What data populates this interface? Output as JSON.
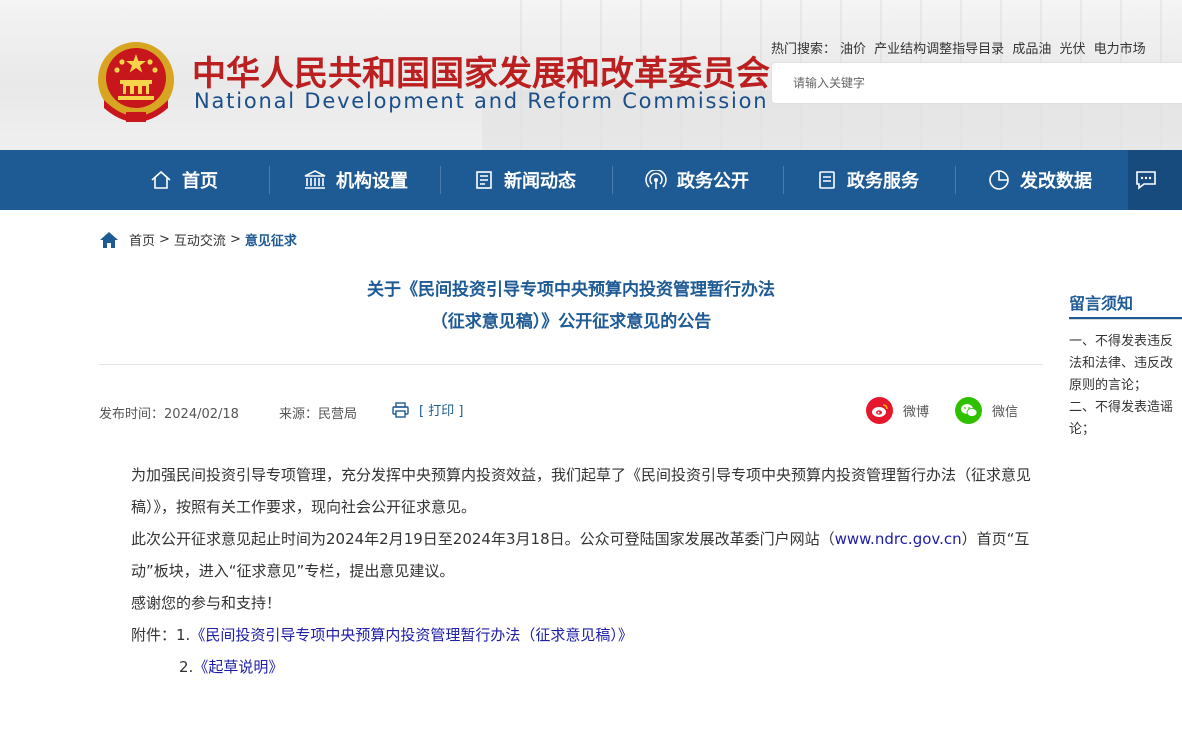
{
  "header": {
    "title_cn": "中华人民共和国国家发展和改革委员会",
    "title_en": "National Development and Reform Commission",
    "hot_search_label": "热门搜索：",
    "hot_search_terms": [
      "油价",
      "产业结构调整指导目录",
      "成品油",
      "光伏",
      "电力市场"
    ],
    "search_placeholder": "请输入关键字"
  },
  "nav": {
    "items": [
      {
        "label": "首页",
        "icon": "home-icon"
      },
      {
        "label": "机构设置",
        "icon": "building-icon"
      },
      {
        "label": "新闻动态",
        "icon": "news-icon"
      },
      {
        "label": "政务公开",
        "icon": "broadcast-icon"
      },
      {
        "label": "政务服务",
        "icon": "document-icon"
      },
      {
        "label": "发改数据",
        "icon": "pie-chart-icon"
      }
    ]
  },
  "breadcrumb": {
    "items": [
      "首页",
      "互动交流",
      "意见征求"
    ],
    "separator": ">"
  },
  "article": {
    "title_line1": "关于《民间投资引导专项中央预算内投资管理暂行办法",
    "title_line2": "（征求意见稿）》公开征求意见的公告",
    "publish_time": "发布时间：2024/02/18",
    "source": "来源：民营局",
    "print_label": "[ 打印 ]",
    "share_weibo": "微博",
    "share_wechat": "微信",
    "para1": "为加强民间投资引导专项管理，充分发挥中央预算内投资效益，我们起草了《民间投资引导专项中央预算内投资管理暂行办法（征求意见稿）》，按照有关工作要求，现向社会公开征求意见。",
    "para2_before": "此次公开征求意见起止时间为2024年2月19日至2024年3月18日。公众可登陆国家发展改革委门户网站（",
    "para2_link": "www.ndrc.gov.cn",
    "para2_after": "）首页“互动”板块，进入“征求意见”专栏，提出意见建议。",
    "para3": "感谢您的参与和支持！",
    "attach_label": "附件：1.",
    "attach1": "《民间投资引导专项中央预算内投资管理暂行办法（征求意见稿）》",
    "attach2_num": "2.",
    "attach2": "《起草说明》"
  },
  "sidebar": {
    "title": "留言须知",
    "lines": [
      "一、不得发表违反",
      "法和法律、违反改",
      "原则的言论；",
      "二、不得发表造谣",
      "论；"
    ]
  },
  "colors": {
    "brand_blue": "#1e5a94",
    "brand_red": "#bb1f1f",
    "link_blue": "#1d1da8",
    "weibo_red": "#e6162d",
    "wechat_green": "#2dc100"
  }
}
